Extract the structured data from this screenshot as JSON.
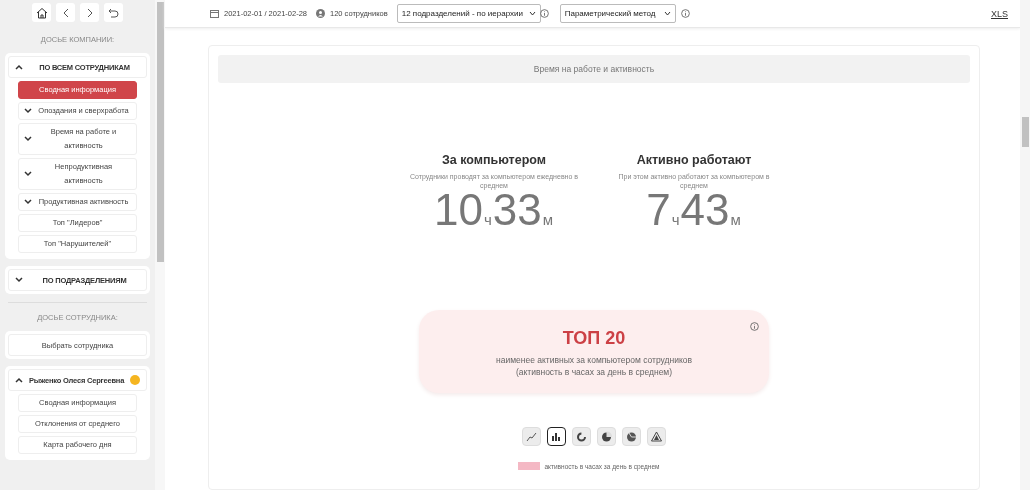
{
  "sidebar": {
    "company_heading": "ДОСЬЕ КОМПАНИИ:",
    "groups": [
      {
        "label": "ПО ВСЕМ СОТРУДНИКАМ",
        "expanded": true,
        "items": [
          {
            "label": "Сводная информация",
            "selected": true,
            "expandable": false
          },
          {
            "label": "Опоздания и сверхработа",
            "selected": false,
            "expandable": true
          },
          {
            "label": "Время на работе и активность",
            "selected": false,
            "expandable": true
          },
          {
            "label": "Непродуктивная активность",
            "selected": false,
            "expandable": true
          },
          {
            "label": "Продуктивная активность",
            "selected": false,
            "expandable": true
          },
          {
            "label": "Топ \"Лидеров\"",
            "selected": false,
            "expandable": false
          },
          {
            "label": "Топ \"Нарушителей\"",
            "selected": false,
            "expandable": false
          }
        ]
      },
      {
        "label": "ПО ПОДРАЗДЕЛЕНИЯМ",
        "expanded": false
      }
    ],
    "employee_heading": "ДОСЬЕ СОТРУДНИКА:",
    "select_employee": "Выбрать сотрудника",
    "employee": {
      "name": "Рыженко Олеся Сергеевна",
      "expanded": true,
      "items": [
        {
          "label": "Сводная информация",
          "selected": false,
          "expandable": false
        },
        {
          "label": "Отклонения от среднего",
          "selected": false,
          "expandable": false
        },
        {
          "label": "Карта рабочего дня",
          "selected": false,
          "expandable": false
        }
      ]
    }
  },
  "toolbar": {
    "period": "2021-02-01 / 2021-02-28",
    "employees": "120 сотрудников",
    "department_select": "12 подразделений - по иерархии",
    "method_select": "Параметрический метод",
    "export_link": "XLS"
  },
  "panel": {
    "title": "Время на работе и активность",
    "stats": [
      {
        "title": "За компьютером",
        "subtitle": "Сотрудники проводят за компьютером ежедневно в среднем",
        "hours": "10",
        "hours_unit": "ч",
        "minutes": "33",
        "minutes_unit": "м"
      },
      {
        "title": "Активно работают",
        "subtitle": "При этом активно работают за компьютером в среднем",
        "hours": "7",
        "hours_unit": "ч",
        "minutes": "43",
        "minutes_unit": "м"
      }
    ],
    "top": {
      "title": "ТОП 20",
      "subtitle": "наименее активных за компьютером сотрудников\n(активность в часах за день в среднем)"
    },
    "chart_types": [
      {
        "kind": "line",
        "selected": false
      },
      {
        "kind": "bar",
        "selected": true
      },
      {
        "kind": "donut",
        "selected": false
      },
      {
        "kind": "pie",
        "selected": false
      },
      {
        "kind": "polar",
        "selected": false
      },
      {
        "kind": "radar",
        "selected": false
      }
    ],
    "legend": {
      "label": "активность в часах за день в среднем",
      "color": "#f4b8c4"
    }
  }
}
